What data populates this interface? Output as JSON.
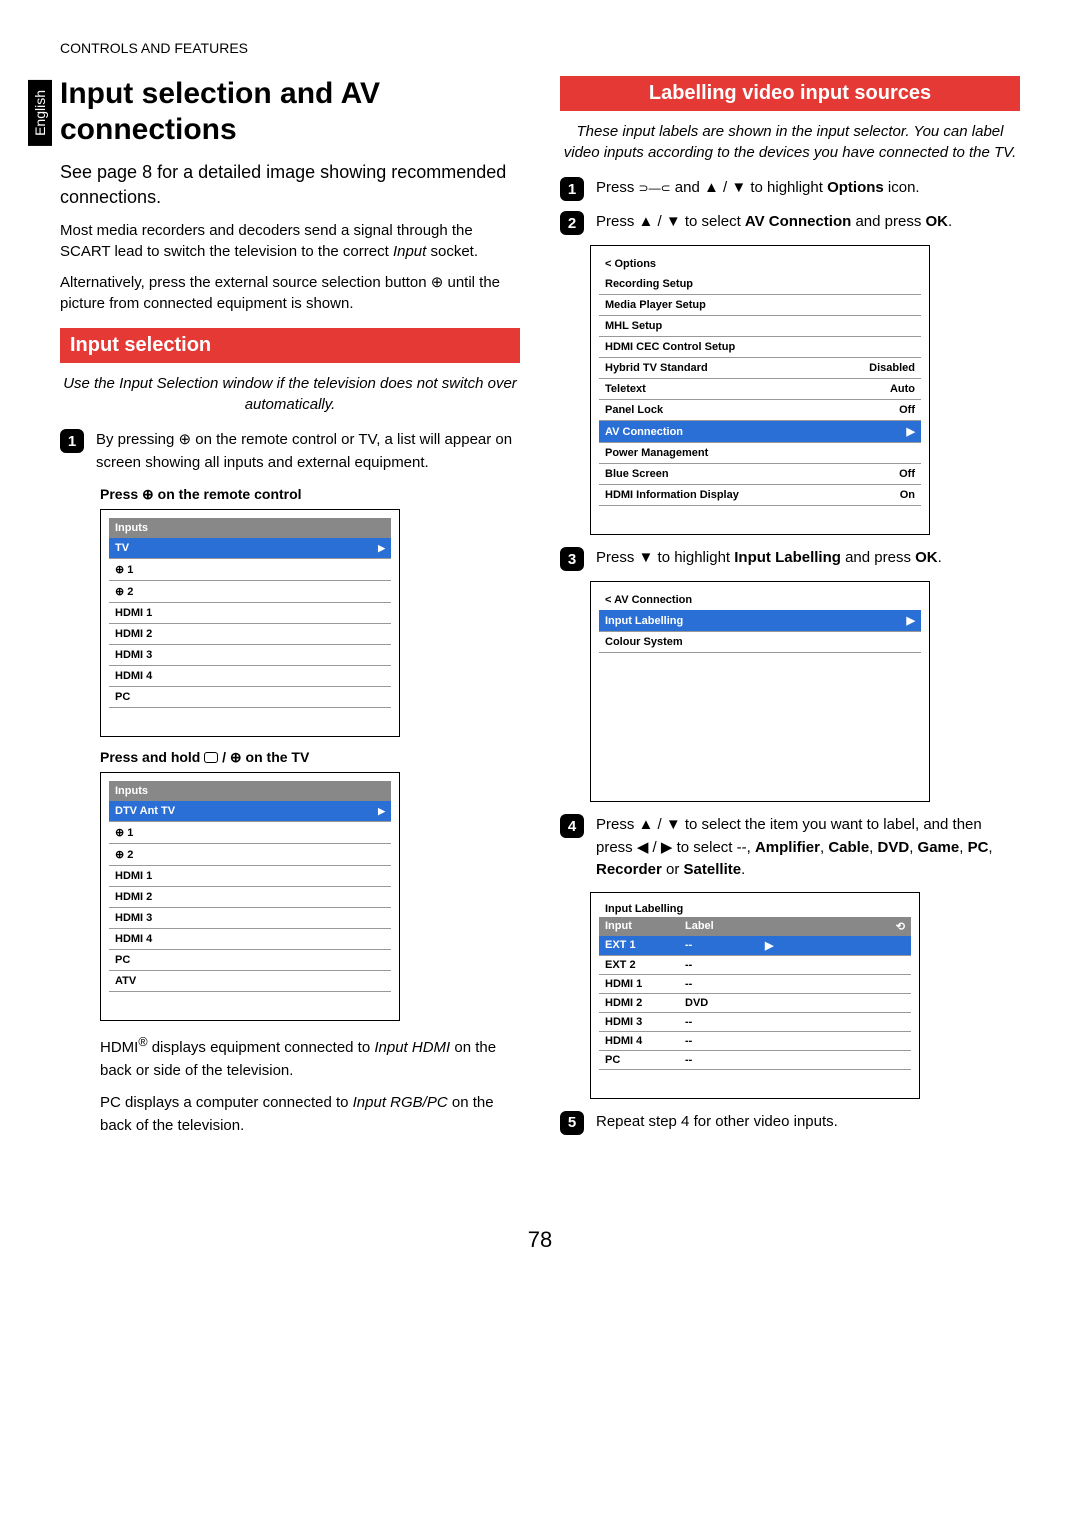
{
  "header": "CONTROLS AND FEATURES",
  "lang_tab": "English",
  "page_number": "78",
  "left": {
    "title": "Input selection and AV connections",
    "lead": "See page 8 for a detailed image showing recommended connections.",
    "p1a": "Most media recorders and decoders send a signal through the SCART lead to switch the television to the correct ",
    "p1b": "Input",
    "p1c": " socket.",
    "p2": "Alternatively, press the external source selection button ⊕ until the picture from connected equipment is shown.",
    "section1": "Input selection",
    "intro1": "Use the Input Selection window if the television does not switch over automatically.",
    "step1": "By pressing ⊕ on the remote control or TV, a list will appear on screen showing all inputs and external equipment.",
    "sub1": "Press ⊕ on the remote control",
    "menu1": {
      "header": "Inputs",
      "items": [
        {
          "label": "TV",
          "hl": true
        },
        {
          "label": "⊕ 1"
        },
        {
          "label": "⊕ 2"
        },
        {
          "label": "HDMI 1"
        },
        {
          "label": "HDMI 2"
        },
        {
          "label": "HDMI 3"
        },
        {
          "label": "HDMI 4"
        },
        {
          "label": "PC"
        }
      ]
    },
    "sub2_a": "Press and hold ",
    "sub2_b": " / ⊕ on the TV",
    "menu2": {
      "header": "Inputs",
      "items": [
        {
          "label": "DTV Ant TV",
          "hl": true
        },
        {
          "label": "⊕ 1"
        },
        {
          "label": "⊕ 2"
        },
        {
          "label": "HDMI 1"
        },
        {
          "label": "HDMI 2"
        },
        {
          "label": "HDMI 3"
        },
        {
          "label": "HDMI 4"
        },
        {
          "label": "PC"
        },
        {
          "label": "ATV"
        }
      ]
    },
    "p3a": "HDMI",
    "p3b": " displays equipment connected to ",
    "p3c": "Input HDMI",
    "p3d": " on the back or side of the television.",
    "p4a": "PC displays a computer connected to ",
    "p4b": "Input RGB/PC",
    "p4c": " on the back of the television."
  },
  "right": {
    "section": "Labelling video input sources",
    "intro": "These input labels are shown in the input selector. You can label video inputs according to the devices you have connected to the TV.",
    "step1_a": "Press ",
    "step1_b": " and ▲ / ▼ to highlight ",
    "step1_c": "Options",
    "step1_d": " icon.",
    "step2_a": "Press ▲ / ▼ to select ",
    "step2_b": "AV Connection",
    "step2_c": " and press ",
    "step2_d": "OK",
    "step2_e": ".",
    "options_menu": {
      "back": "< Options",
      "items": [
        {
          "label": "Recording Setup",
          "val": ""
        },
        {
          "label": "Media Player Setup",
          "val": ""
        },
        {
          "label": "MHL Setup",
          "val": ""
        },
        {
          "label": "HDMI CEC Control Setup",
          "val": ""
        },
        {
          "label": "Hybrid TV Standard",
          "val": "Disabled"
        },
        {
          "label": "Teletext",
          "val": "Auto"
        },
        {
          "label": "Panel Lock",
          "val": "Off"
        },
        {
          "label": "AV Connection",
          "val": "▶",
          "hl": true
        },
        {
          "label": "Power Management",
          "val": ""
        },
        {
          "label": "Blue Screen",
          "val": "Off"
        },
        {
          "label": "HDMI Information Display",
          "val": "On"
        }
      ]
    },
    "step3_a": "Press ▼ to highlight ",
    "step3_b": "Input Labelling",
    "step3_c": " and press ",
    "step3_d": "OK",
    "step3_e": ".",
    "av_menu": {
      "back": "< AV Connection",
      "items": [
        {
          "label": "Input Labelling",
          "val": "▶",
          "hl": true
        },
        {
          "label": "Colour System",
          "val": ""
        }
      ]
    },
    "step4_a": "Press ▲ / ▼ to select the item you want to label, and then press ◀ / ▶ to select --, ",
    "step4_b": "Amplifier",
    "step4_c": ", ",
    "step4_d": "Cable",
    "step4_e": ", ",
    "step4_f": "DVD",
    "step4_g": ", ",
    "step4_h": "Game",
    "step4_i": ", ",
    "step4_j": "PC",
    "step4_k": ", ",
    "step4_l": "Recorder",
    "step4_m": " or ",
    "step4_n": "Satellite",
    "step4_o": ".",
    "label_table": {
      "title": "Input Labelling",
      "h1": "Input",
      "h2": "Label",
      "rows": [
        {
          "input": "EXT 1",
          "label": "--",
          "hl": true,
          "arrow": true
        },
        {
          "input": "EXT 2",
          "label": "--"
        },
        {
          "input": "HDMI 1",
          "label": "--"
        },
        {
          "input": "HDMI 2",
          "label": "DVD"
        },
        {
          "input": "HDMI 3",
          "label": "--"
        },
        {
          "input": "HDMI 4",
          "label": "--"
        },
        {
          "input": "PC",
          "label": "--"
        }
      ]
    },
    "step5": "Repeat step 4 for other video inputs."
  }
}
